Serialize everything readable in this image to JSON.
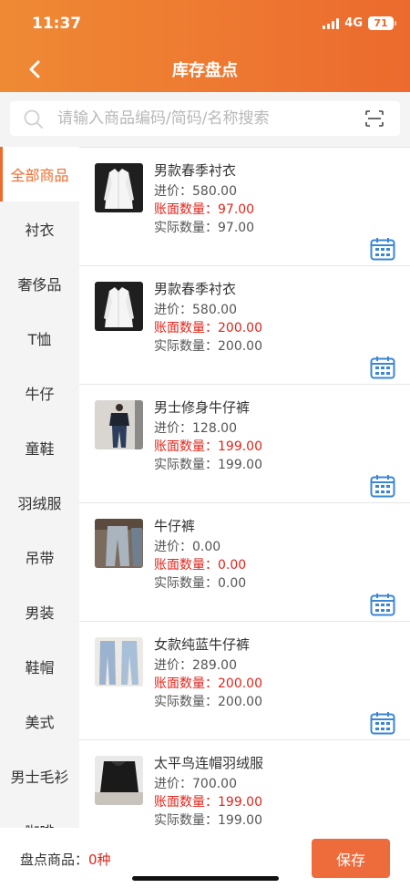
{
  "status": {
    "time": "11:37",
    "network": "4G",
    "battery": "71"
  },
  "header": {
    "title": "库存盘点"
  },
  "search": {
    "placeholder": "请输入商品编码/简码/名称搜索"
  },
  "categories": [
    {
      "label": "全部商品",
      "active": true
    },
    {
      "label": "衬衣"
    },
    {
      "label": "奢侈品"
    },
    {
      "label": "T恤"
    },
    {
      "label": "牛仔"
    },
    {
      "label": "童鞋"
    },
    {
      "label": "羽绒服"
    },
    {
      "label": "吊带"
    },
    {
      "label": "男装"
    },
    {
      "label": "鞋帽"
    },
    {
      "label": "美式"
    },
    {
      "label": "男士毛衫"
    },
    {
      "label": "咖啡"
    }
  ],
  "products": [
    {
      "name": "男款春季衬衣",
      "price": "进价：580.00",
      "book": "账面数量：97.00",
      "actual": "实际数量：97.00",
      "thumb": "white-shirt"
    },
    {
      "name": "男款春季衬衣",
      "price": "进价：580.00",
      "book": "账面数量：200.00",
      "actual": "实际数量：200.00",
      "thumb": "white-shirt"
    },
    {
      "name": "男士修身牛仔裤",
      "price": "进价：128.00",
      "book": "账面数量：199.00",
      "actual": "实际数量：199.00",
      "thumb": "man-jeans"
    },
    {
      "name": "牛仔裤",
      "price": "进价：0.00",
      "book": "账面数量：0.00",
      "actual": "实际数量：0.00",
      "thumb": "jeans"
    },
    {
      "name": "女款纯蓝牛仔裤",
      "price": "进价：289.00",
      "book": "账面数量：200.00",
      "actual": "实际数量：200.00",
      "thumb": "blue-jeans"
    },
    {
      "name": "太平鸟连帽羽绒服",
      "price": "进价：700.00",
      "book": "账面数量：199.00",
      "actual": "实际数量：199.00",
      "thumb": "down-jacket"
    }
  ],
  "footer": {
    "label": "盘点商品：",
    "count": "0种",
    "save_label": "保存"
  },
  "colors": {
    "accent": "#ee6b2d",
    "red": "#e1251b",
    "blue": "#3a86d4"
  }
}
